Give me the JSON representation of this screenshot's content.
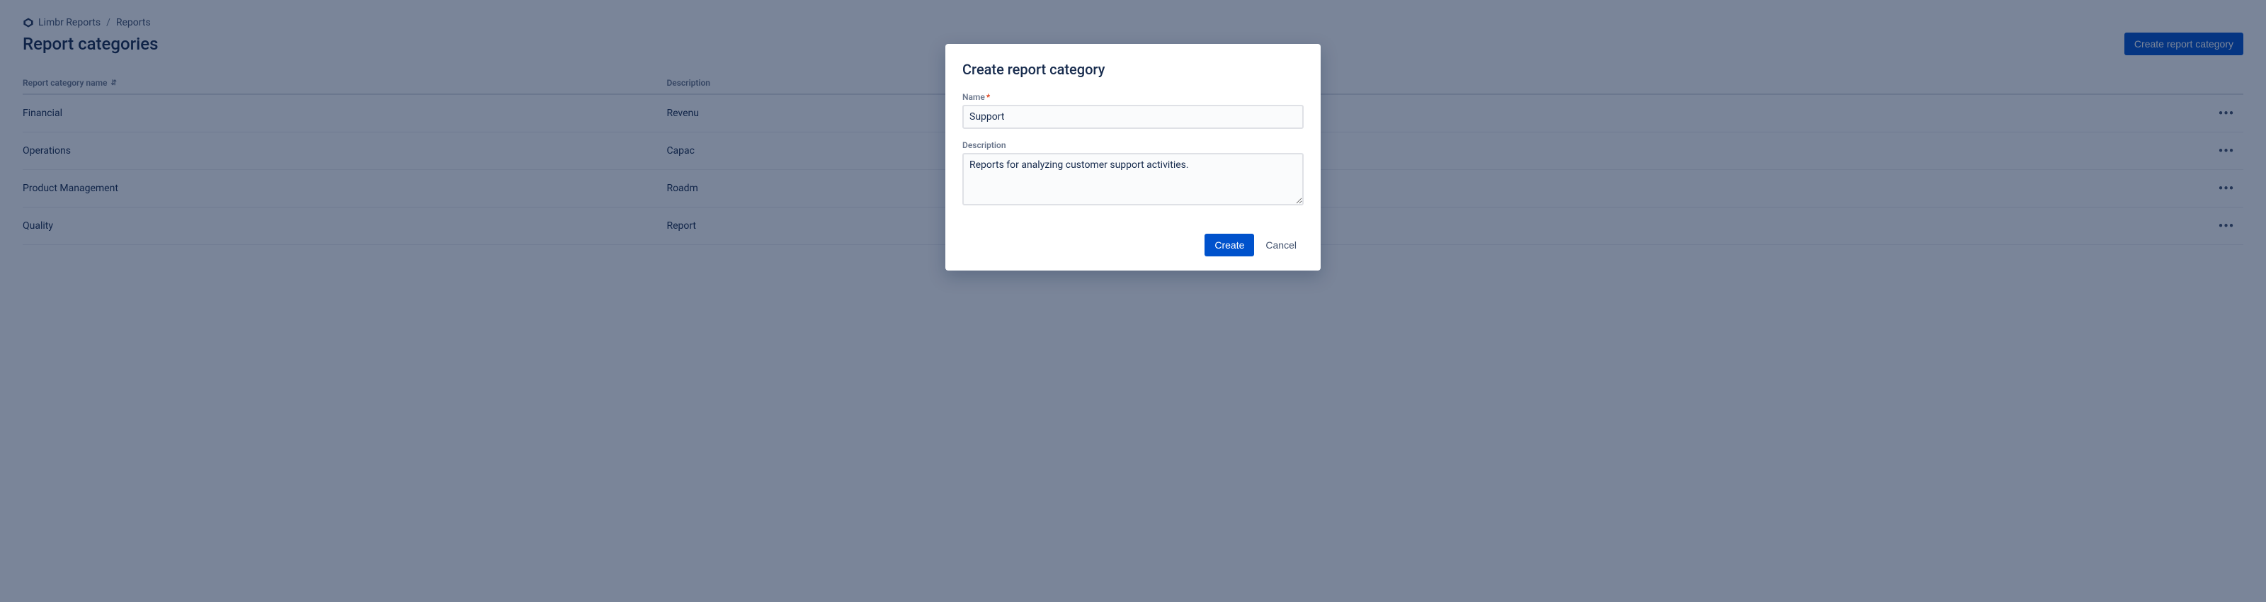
{
  "breadcrumb": {
    "app": "Limbr Reports",
    "section": "Reports",
    "separator": "/"
  },
  "header": {
    "title": "Report categories",
    "create_button": "Create report category"
  },
  "table": {
    "columns": {
      "name": "Report category name",
      "description": "Description"
    },
    "rows": [
      {
        "name": "Financial",
        "description": "Revenu"
      },
      {
        "name": "Operations",
        "description": "Capac"
      },
      {
        "name": "Product Management",
        "description": "Roadm"
      },
      {
        "name": "Quality",
        "description": "Report"
      }
    ]
  },
  "modal": {
    "title": "Create report category",
    "name_label": "Name",
    "name_value": "Support",
    "description_label": "Description",
    "description_value": "Reports for analyzing customer support activities.",
    "create_label": "Create",
    "cancel_label": "Cancel"
  },
  "icons": {
    "kebab": "•••",
    "sort": "⇵"
  }
}
